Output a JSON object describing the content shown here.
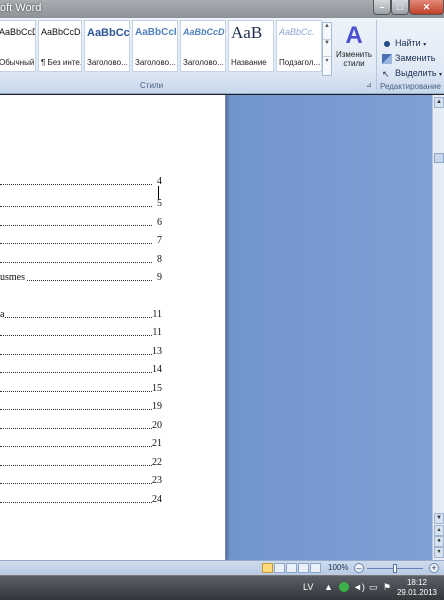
{
  "window": {
    "title": "oft Word"
  },
  "ribbon": {
    "styles": [
      {
        "sample": "AaBbCcDc",
        "label": "Обычный"
      },
      {
        "sample": "AaBbCcDc",
        "label": "¶ Без инте..."
      },
      {
        "sample": "AaBbCc",
        "label": "Заголово..."
      },
      {
        "sample": "AaBbCcI",
        "label": "Заголово..."
      },
      {
        "sample": "AaBbCcD",
        "label": "Заголово..."
      },
      {
        "sample": "AaB",
        "label": "Название"
      },
      {
        "sample": "AaBbCc.",
        "label": "Подзагол..."
      }
    ],
    "change_styles_label_1": "Изменить",
    "change_styles_label_2": "стили",
    "group_styles_label": "Стили",
    "group_edit_label": "Редактирование",
    "find_label": "Найти",
    "replace_label": "Заменить",
    "select_label": "Выделить"
  },
  "document": {
    "toc": [
      {
        "text": "",
        "page": "4"
      },
      {
        "text": "",
        "page": "5"
      },
      {
        "text": "",
        "page": "6"
      },
      {
        "text": "",
        "page": "7"
      },
      {
        "text": "",
        "page": "8"
      },
      {
        "text": "usmes",
        "page": "9"
      },
      {
        "text": "a",
        "page": "11"
      },
      {
        "text": "",
        "page": "11"
      },
      {
        "text": "",
        "page": "13"
      },
      {
        "text": "",
        "page": "14"
      },
      {
        "text": "",
        "page": "15"
      },
      {
        "text": "",
        "page": "19"
      },
      {
        "text": "",
        "page": "20"
      },
      {
        "text": "",
        "page": "21"
      },
      {
        "text": "",
        "page": "22"
      },
      {
        "text": "",
        "page": "23"
      },
      {
        "text": "",
        "page": "24"
      }
    ]
  },
  "statusbar": {
    "zoom": "100%"
  },
  "taskbar": {
    "lang": "LV",
    "time": "18:12",
    "date": "29.01.2013"
  }
}
